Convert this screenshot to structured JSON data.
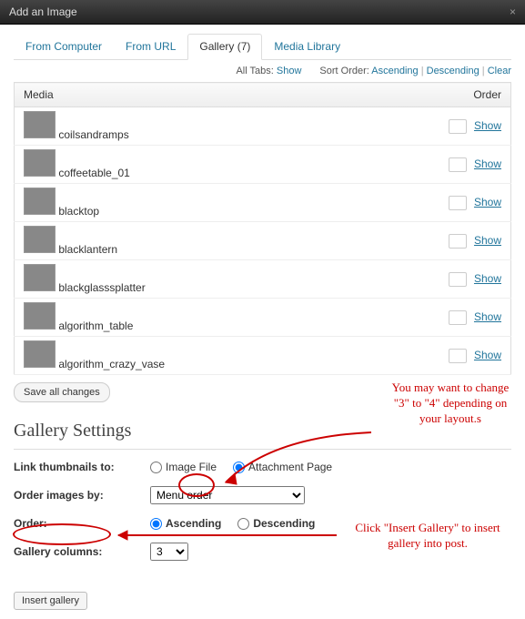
{
  "header": {
    "title": "Add an Image"
  },
  "tabs": {
    "items": [
      {
        "label": "From Computer"
      },
      {
        "label": "From URL"
      },
      {
        "label": "Gallery (7)"
      },
      {
        "label": "Media Library"
      }
    ]
  },
  "toolbar": {
    "alltabs_label": "All Tabs:",
    "alltabs_link": "Show",
    "sort_label": "Sort Order:",
    "sort_asc": "Ascending",
    "sort_desc": "Descending",
    "sort_clear": "Clear"
  },
  "table": {
    "col_media": "Media",
    "col_order": "Order",
    "rows": [
      {
        "name": "coilsandramps",
        "action": "Show"
      },
      {
        "name": "coffeetable_01",
        "action": "Show"
      },
      {
        "name": "blacktop",
        "action": "Show"
      },
      {
        "name": "blacklantern",
        "action": "Show"
      },
      {
        "name": "blackglasssplatter",
        "action": "Show"
      },
      {
        "name": "algorithm_table",
        "action": "Show"
      },
      {
        "name": "algorithm_crazy_vase",
        "action": "Show"
      }
    ]
  },
  "buttons": {
    "save_all": "Save all changes",
    "insert": "Insert gallery"
  },
  "settings": {
    "heading": "Gallery Settings",
    "link_label": "Link thumbnails to:",
    "link_opt1": "Image File",
    "link_opt2": "Attachment Page",
    "orderby_label": "Order images by:",
    "orderby_value": "Menu order",
    "order_label": "Order:",
    "order_asc": "Ascending",
    "order_desc": "Descending",
    "cols_label": "Gallery columns:",
    "cols_value": "3"
  },
  "annotations": {
    "note1": "You may want to change \"3\" to \"4\" depending on your layout.s",
    "note2": "Click \"Insert Gallery\" to insert gallery into post."
  }
}
